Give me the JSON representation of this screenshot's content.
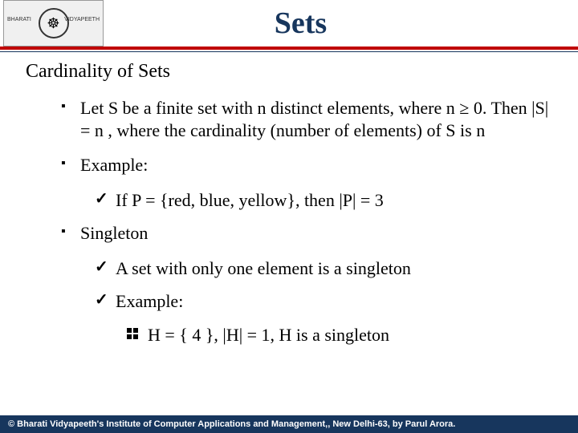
{
  "header": {
    "title": "Sets",
    "logo_left": "BHARATI",
    "logo_right": "VIDYAPEETH"
  },
  "subtitle": "Cardinality of Sets",
  "bullets": {
    "def": "Let S be a finite set with n distinct elements, where n ≥ 0. Then |S| = n , where the cardinality (number of elements) of S is n",
    "example_label": "Example:",
    "example_text": "If P = {red, blue, yellow}, then  |P| = 3",
    "singleton_label": "Singleton",
    "singleton_def": " A set with only one element is a singleton",
    "singleton_example_label": "Example:",
    "singleton_example_text": "H = { 4 }, |H| = 1, H is a singleton"
  },
  "footer": "© Bharati Vidyapeeth's Institute of Computer Applications and Management,, New Delhi-63, by Parul Arora."
}
